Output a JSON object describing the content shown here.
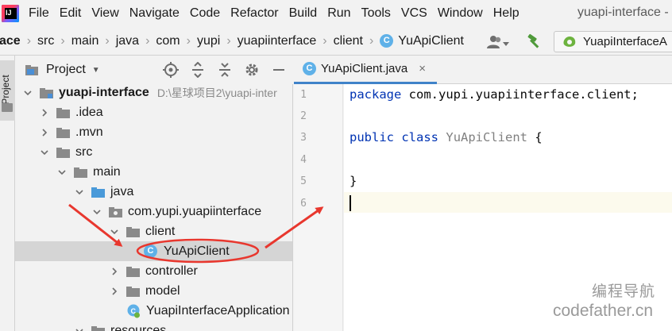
{
  "menubar": {
    "items": [
      "File",
      "Edit",
      "View",
      "Navigate",
      "Code",
      "Refactor",
      "Build",
      "Run",
      "Tools",
      "VCS",
      "Window",
      "Help"
    ],
    "window_title": "yuapi-interface -"
  },
  "breadcrumb": {
    "items": [
      "ace",
      "src",
      "main",
      "java",
      "com",
      "yupi",
      "yuapiinterface",
      "client",
      "YuApiClient"
    ],
    "class_icon_letter": "C"
  },
  "run_config": {
    "label": "YuapiInterfaceA"
  },
  "side_strip": {
    "project_tab_label": "Project"
  },
  "project_panel": {
    "title": "Project",
    "tree": [
      {
        "label": "yuapi-interface",
        "path": "D:\\星球项目2\\yuapi-inter",
        "bold": true,
        "icon": "module-folder-icon",
        "arrow": "expanded",
        "indent": 0
      },
      {
        "label": ".idea",
        "icon": "folder-icon",
        "arrow": "collapsed",
        "indent": 1
      },
      {
        "label": ".mvn",
        "icon": "folder-icon",
        "arrow": "collapsed",
        "indent": 1
      },
      {
        "label": "src",
        "icon": "folder-icon",
        "arrow": "expanded",
        "indent": 1
      },
      {
        "label": "main",
        "icon": "folder-icon",
        "arrow": "expanded",
        "indent": 2
      },
      {
        "label": "java",
        "icon": "source-folder-icon",
        "arrow": "expanded",
        "indent": 3
      },
      {
        "label": "com.yupi.yuapiinterface",
        "icon": "package-icon",
        "arrow": "expanded",
        "indent": 4
      },
      {
        "label": "client",
        "icon": "folder-icon",
        "arrow": "expanded",
        "indent": 5
      },
      {
        "label": "YuApiClient",
        "icon": "java-class-icon",
        "arrow": "none",
        "indent": 6,
        "selected": true
      },
      {
        "label": "controller",
        "icon": "folder-icon",
        "arrow": "collapsed",
        "indent": 5
      },
      {
        "label": "model",
        "icon": "folder-icon",
        "arrow": "collapsed",
        "indent": 5
      },
      {
        "label": "YuapiInterfaceApplication",
        "icon": "spring-app-icon",
        "arrow": "none",
        "indent": 5
      },
      {
        "label": "resources",
        "icon": "folder-icon",
        "arrow": "expanded",
        "indent": 3
      }
    ]
  },
  "editor": {
    "tab_label": "YuApiClient.java",
    "tab_close": "×",
    "line_numbers": [
      "1",
      "2",
      "3",
      "4",
      "5",
      "6"
    ],
    "code": {
      "line1_kw": "package",
      "line1_rest": " com.yupi.yuapiinterface.client;",
      "line3_kw1": "public",
      "line3_kw2": "class",
      "line3_name": "YuApiClient",
      "line3_brace": " {",
      "line5": "}"
    }
  },
  "watermark": {
    "line1": "编程导航",
    "line2": "codefather.cn"
  },
  "colors": {
    "accent_tab": "#4083c9",
    "keyword": "#0033b3",
    "annotation_red": "#e8372e",
    "selection": "#d5d5d5"
  }
}
